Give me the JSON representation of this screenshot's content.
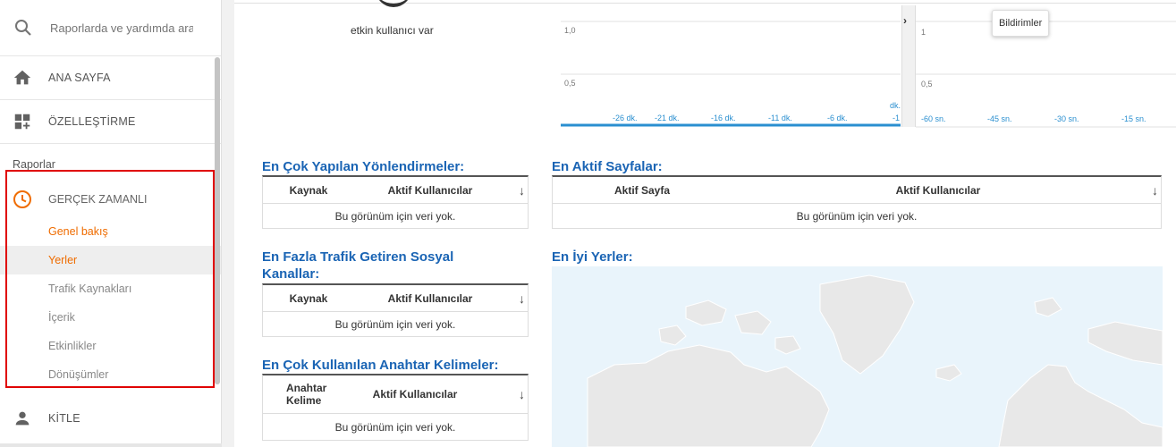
{
  "sidebar": {
    "search_placeholder": "Raporlarda ve yardımda ara",
    "home_label": "ANA SAYFA",
    "customize_label": "ÖZELLEŞTİRME",
    "reports_section": "Raporlar",
    "realtime_label": "GERÇEK ZAMANLI",
    "realtime_items": [
      {
        "label": "Genel bakış"
      },
      {
        "label": "Yerler"
      },
      {
        "label": "Trafik Kaynakları"
      },
      {
        "label": "İçerik"
      },
      {
        "label": "Etkinlikler"
      },
      {
        "label": "Dönüşümler"
      }
    ],
    "audience_label": "KİTLE"
  },
  "top": {
    "active_users_text": "etkin kullanıcı var",
    "tooltip": "Bildirimler"
  },
  "chart_minutes": {
    "type": "bar",
    "y_ticks": [
      "1,0",
      "0,5"
    ],
    "x_ticks": [
      "-26 dk.",
      "-21 dk.",
      "-16 dk.",
      "-11 dk.",
      "-6 dk.",
      "-1"
    ],
    "x_last_unit": "dk.",
    "ylim": [
      0,
      1
    ]
  },
  "chart_seconds": {
    "type": "bar",
    "y_ticks": [
      "1",
      "0,5"
    ],
    "x_ticks": [
      "-60 sn.",
      "-45 sn.",
      "-30 sn.",
      "-15 sn."
    ],
    "ylim": [
      0,
      1
    ]
  },
  "referrals": {
    "title": "En Çok Yapılan Yönlendirmeler:",
    "col1": "Kaynak",
    "col2": "Aktif Kullanıcılar",
    "empty": "Bu görünüm için veri yok."
  },
  "social": {
    "title": "En Fazla Trafik Getiren Sosyal Kanallar:",
    "col1": "Kaynak",
    "col2": "Aktif Kullanıcılar",
    "empty": "Bu görünüm için veri yok."
  },
  "keywords": {
    "title": "En Çok Kullanılan Anahtar Kelimeler:",
    "col1": "Anahtar Kelime",
    "col2": "Aktif Kullanıcılar",
    "empty": "Bu görünüm için veri yok."
  },
  "pages": {
    "title": "En Aktif Sayfalar:",
    "col1": "Aktif Sayfa",
    "col2": "Aktif Kullanıcılar",
    "empty": "Bu görünüm için veri yok."
  },
  "locations": {
    "title": "En İyi Yerler:"
  },
  "colors": {
    "accent_orange": "#ef6c00",
    "title_blue": "#1a64b4",
    "highlight_red": "#e00000",
    "axis_blue": "#2a8fd0"
  }
}
